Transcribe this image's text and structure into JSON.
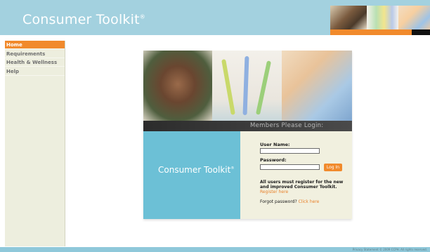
{
  "header": {
    "brand": "Consumer Toolkit",
    "trademark": "®",
    "accent_color": "#f18a2c",
    "header_color": "#a3d1df"
  },
  "sidebar": {
    "items": [
      {
        "label": "Home",
        "active": true
      },
      {
        "label": "Requirements",
        "active": false
      },
      {
        "label": "Health & Wellness",
        "active": false
      },
      {
        "label": "Help",
        "active": false
      }
    ]
  },
  "login": {
    "banner": "Members Please Login:",
    "panel_brand": "Consumer Toolkit",
    "panel_trademark": "®",
    "username_label": "User Name:",
    "password_label": "Password:",
    "username_value": "",
    "password_value": "",
    "button_label": "Log In",
    "notice": "All users must register for the new and improved Consumer Toolkit.",
    "register_link": "Register here",
    "forgot_text": "Forgot password?",
    "forgot_link": "Click here"
  },
  "footer": {
    "copyright": "Privacy Statement  © 2009 CCPH. All rights reserved."
  }
}
